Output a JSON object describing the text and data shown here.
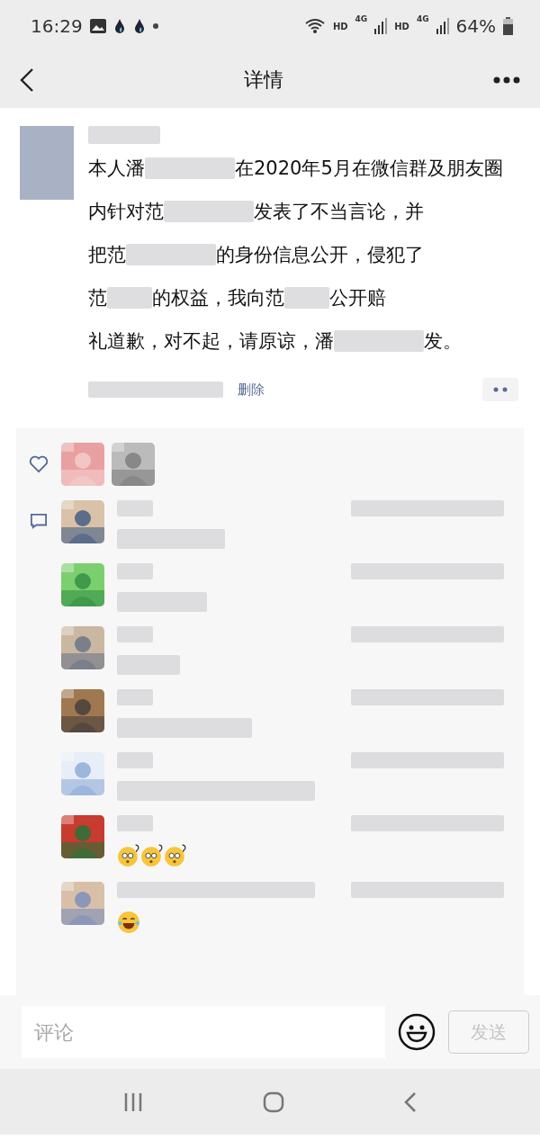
{
  "status_bar": {
    "time": "16:29",
    "network": [
      {
        "hd": "HD",
        "gen": "4G"
      },
      {
        "hd": "HD",
        "gen": "4G"
      }
    ],
    "battery": "64%"
  },
  "header": {
    "title": "详情"
  },
  "post": {
    "lines": [
      [
        {
          "kind": "text",
          "text": "本人潘"
        },
        {
          "kind": "blur"
        },
        {
          "kind": "text",
          "text": "在2020年5月在微信群及朋友圈"
        }
      ],
      [
        {
          "kind": "text",
          "text": "内针对范"
        },
        {
          "kind": "blur"
        },
        {
          "kind": "text",
          "text": "发表了不当言论，并"
        }
      ],
      [
        {
          "kind": "text",
          "text": "把范"
        },
        {
          "kind": "blur"
        },
        {
          "kind": "text",
          "text": "的身份信息公开，侵犯了"
        }
      ],
      [
        {
          "kind": "text",
          "text": "范"
        },
        {
          "kind": "blur"
        },
        {
          "kind": "text",
          "text": "的权益，我向范"
        },
        {
          "kind": "blur"
        },
        {
          "kind": "text",
          "text": "公开赔"
        }
      ],
      [
        {
          "kind": "text",
          "text": "礼道歉，对不起，请原谅，潘"
        },
        {
          "kind": "blur"
        },
        {
          "kind": "text",
          "text": "发。"
        }
      ]
    ],
    "delete_label": "删除"
  },
  "comments": [
    {
      "kind": "blurred"
    },
    {
      "kind": "blurred"
    },
    {
      "kind": "blurred"
    },
    {
      "kind": "blurred"
    },
    {
      "kind": "blurred"
    },
    {
      "kind": "reactions",
      "reactions": [
        {
          "kind": "puzzled"
        },
        {
          "kind": "puzzled"
        },
        {
          "kind": "puzzled"
        }
      ]
    },
    {
      "kind": "reactions",
      "reactions": [
        {
          "kind": "laughing"
        }
      ]
    }
  ],
  "composer": {
    "placeholder": "评论",
    "send_button": {
      "label": "发送",
      "disabled": true
    }
  }
}
